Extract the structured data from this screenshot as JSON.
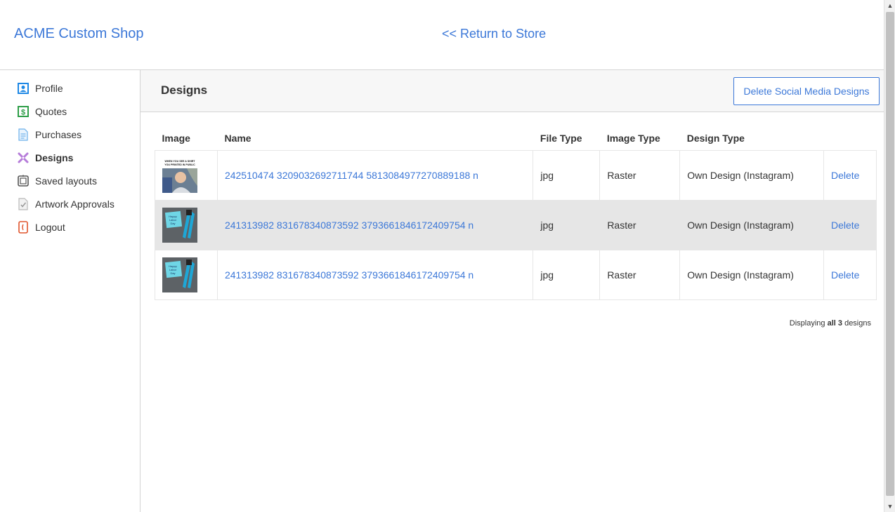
{
  "header": {
    "brand": "ACME Custom Shop",
    "return_link": "<< Return to Store"
  },
  "sidebar": {
    "items": [
      {
        "label": "Profile",
        "icon": "profile-icon",
        "active": false
      },
      {
        "label": "Quotes",
        "icon": "quotes-icon",
        "active": false
      },
      {
        "label": "Purchases",
        "icon": "purchases-icon",
        "active": false
      },
      {
        "label": "Designs",
        "icon": "designs-icon",
        "active": true
      },
      {
        "label": "Saved layouts",
        "icon": "saved-layouts-icon",
        "active": false
      },
      {
        "label": "Artwork Approvals",
        "icon": "artwork-approvals-icon",
        "active": false
      },
      {
        "label": "Logout",
        "icon": "logout-icon",
        "active": false
      }
    ]
  },
  "panel": {
    "title": "Designs",
    "delete_social_button": "Delete Social Media Designs"
  },
  "table": {
    "headers": [
      "Image",
      "Name",
      "File Type",
      "Image Type",
      "Design Type",
      ""
    ],
    "rows": [
      {
        "thumbnail": "meme-photo-thumbnail",
        "thumb_caption": "WHEN YOU SEE A SHIRT YOU PRINTED IN PUBLIC",
        "name": "242510474 3209032692711744 5813084977270889188 n",
        "file_type": "jpg",
        "image_type": "Raster",
        "design_type": "Own Design (Instagram)",
        "action": "Delete"
      },
      {
        "thumbnail": "sticky-note-pliers-thumbnail",
        "thumb_caption": "Happy Labor Day",
        "name": "241313982 831678340873592 3793661846172409754 n",
        "file_type": "jpg",
        "image_type": "Raster",
        "design_type": "Own Design (Instagram)",
        "action": "Delete"
      },
      {
        "thumbnail": "sticky-note-pliers-thumbnail",
        "thumb_caption": "Happy Labor Day",
        "name": "241313982 831678340873592 3793661846172409754 n",
        "file_type": "jpg",
        "image_type": "Raster",
        "design_type": "Own Design (Instagram)",
        "action": "Delete"
      }
    ]
  },
  "footer": {
    "displaying_prefix": "Displaying ",
    "displaying_all": "all 3",
    "displaying_suffix": " designs"
  },
  "colors": {
    "link": "#3c78d8",
    "row_shade": "#e6e6e6",
    "panel_head": "#f7f7f7"
  }
}
